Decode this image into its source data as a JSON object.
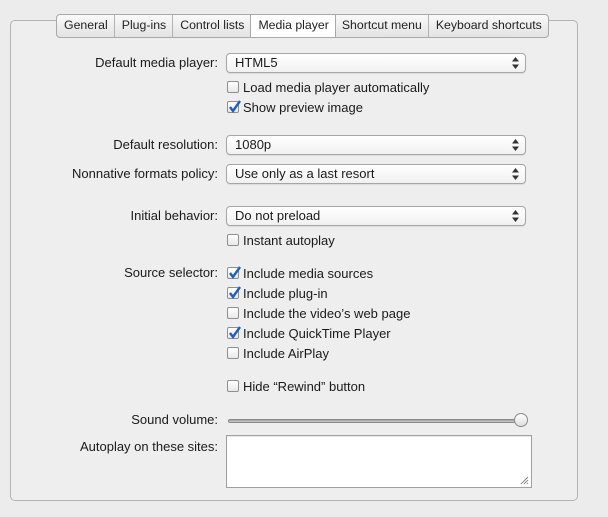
{
  "tabs": [
    {
      "label": "General"
    },
    {
      "label": "Plug-ins"
    },
    {
      "label": "Control lists"
    },
    {
      "label": "Media player"
    },
    {
      "label": "Shortcut menu"
    },
    {
      "label": "Keyboard shortcuts"
    }
  ],
  "active_tab": "Media player",
  "fields": {
    "default_media_player": {
      "label": "Default media player:",
      "value": "HTML5"
    },
    "load_auto": {
      "label": "Load media player automatically",
      "checked": false
    },
    "show_preview": {
      "label": "Show preview image",
      "checked": true
    },
    "default_resolution": {
      "label": "Default resolution:",
      "value": "1080p"
    },
    "nonnative_policy": {
      "label": "Nonnative formats policy:",
      "value": "Use only as a last resort"
    },
    "initial_behavior": {
      "label": "Initial behavior:",
      "value": "Do not preload"
    },
    "instant_autoplay": {
      "label": "Instant autoplay",
      "checked": false
    },
    "source_selector": {
      "label": "Source selector:"
    },
    "include_media_sources": {
      "label": "Include media sources",
      "checked": true
    },
    "include_plugin": {
      "label": "Include plug-in",
      "checked": true
    },
    "include_video_page": {
      "label": "Include the video’s web page",
      "checked": false
    },
    "include_quicktime": {
      "label": "Include QuickTime Player",
      "checked": true
    },
    "include_airplay": {
      "label": "Include AirPlay",
      "checked": false
    },
    "hide_rewind": {
      "label": "Hide “Rewind” button",
      "checked": false
    },
    "sound_volume": {
      "label": "Sound volume:",
      "level_percent": 100
    },
    "autoplay_sites": {
      "label": "Autoplay on these sites:",
      "value": ""
    }
  },
  "colors": {
    "check": "#1f5fbf",
    "panel_bg": "#eeeeee"
  }
}
